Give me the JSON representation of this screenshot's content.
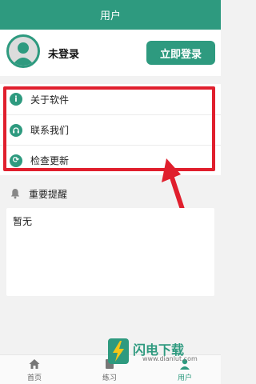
{
  "header": {
    "title": "用户"
  },
  "user": {
    "status": "未登录",
    "login_button": "立即登录"
  },
  "menu": {
    "items": [
      {
        "label": "关于软件",
        "icon": "info-icon"
      },
      {
        "label": "联系我们",
        "icon": "headset-icon"
      },
      {
        "label": "检查更新",
        "icon": "refresh-icon"
      }
    ]
  },
  "reminder": {
    "title": "重要提醒",
    "content": "暂无"
  },
  "nav": {
    "items": [
      {
        "label": "首页",
        "icon": "home-icon"
      },
      {
        "label": "练习",
        "icon": "practice-icon"
      },
      {
        "label": "用户",
        "icon": "user-icon",
        "active": true
      }
    ]
  },
  "watermark": {
    "text": "闪电下载",
    "url": "www.dianlut.com"
  },
  "colors": {
    "primary": "#2e9a7f",
    "highlight": "#e01f2d"
  }
}
